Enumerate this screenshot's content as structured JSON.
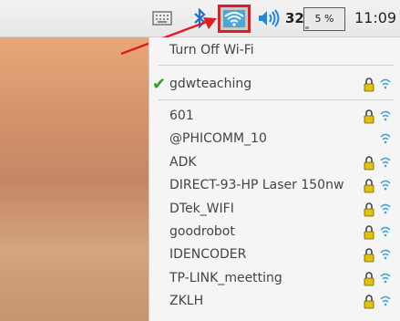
{
  "taskbar": {
    "volume_value": "32",
    "cpu_usage": "5 %",
    "clock": "11:09",
    "icons": [
      "keyboard-icon",
      "bluetooth-icon",
      "wifi-icon",
      "volume-icon"
    ]
  },
  "menu": {
    "toggle_label": "Turn Off Wi-Fi",
    "connected": {
      "ssid": "gdwteaching",
      "secured": true
    },
    "networks": [
      {
        "ssid": "601",
        "secured": true
      },
      {
        "ssid": "@PHICOMM_10",
        "secured": false
      },
      {
        "ssid": "ADK",
        "secured": true
      },
      {
        "ssid": "DIRECT-93-HP Laser 150nw",
        "secured": true
      },
      {
        "ssid": "DTek_WIFI",
        "secured": true
      },
      {
        "ssid": "goodrobot",
        "secured": true
      },
      {
        "ssid": "IDENCODER",
        "secured": true
      },
      {
        "ssid": "TP-LINK_meetting",
        "secured": true
      },
      {
        "ssid": "ZKLH",
        "secured": true
      }
    ]
  },
  "colors": {
    "highlight_box": "#e31b23",
    "wifi_blue": "#49a8d6",
    "check_green": "#2e9e2e"
  }
}
